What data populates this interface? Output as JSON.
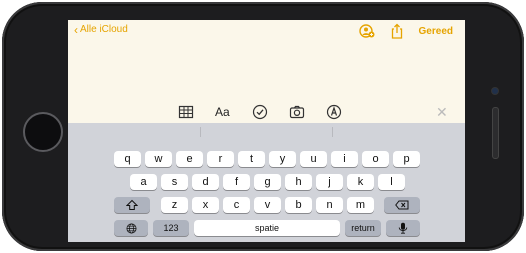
{
  "nav": {
    "back_label": "Alle iCloud",
    "done_label": "Gereed",
    "icons": [
      "collaborate-icon",
      "share-icon"
    ]
  },
  "toolbar": {
    "icons": [
      "table-icon",
      "text-format-icon",
      "checklist-icon",
      "camera-icon",
      "markup-icon",
      "close-icon"
    ],
    "format_label": "Aa",
    "close_label": "✕"
  },
  "keyboard": {
    "row1": [
      "q",
      "w",
      "e",
      "r",
      "t",
      "y",
      "u",
      "i",
      "o",
      "p"
    ],
    "row2": [
      "a",
      "s",
      "d",
      "f",
      "g",
      "h",
      "j",
      "k",
      "l"
    ],
    "row3": [
      "z",
      "x",
      "c",
      "v",
      "b",
      "n",
      "m"
    ],
    "numbers_label": "123",
    "space_label": "spatie",
    "return_label": "return",
    "shift_icon": "shift-icon",
    "delete_icon": "delete-icon",
    "globe_icon": "globe-icon",
    "mic_icon": "microphone-icon"
  },
  "colors": {
    "accent": "#e6a400",
    "note_background": "#fbf7ea",
    "keyboard_background": "#d1d3d9"
  }
}
